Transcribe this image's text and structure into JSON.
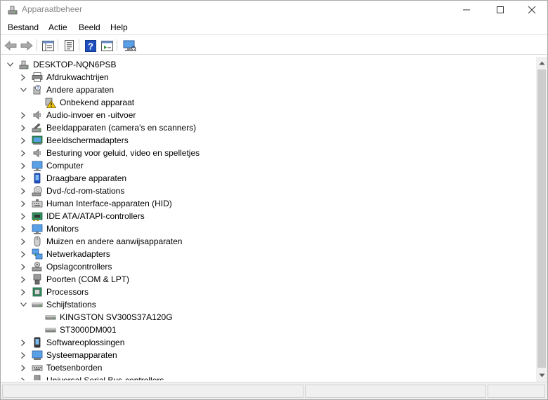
{
  "window": {
    "title": "Apparaatbeheer"
  },
  "menu": {
    "items": [
      "Bestand",
      "Actie",
      "Beeld",
      "Help"
    ]
  },
  "toolbar": {
    "buttons": [
      "back-icon",
      "forward-icon",
      "properties-icon",
      "update-driver-icon",
      "help-icon",
      "console-icon",
      "scan-hardware-icon"
    ]
  },
  "tree": {
    "root": "DESKTOP-NQN6PSB",
    "items": [
      {
        "label": "Afdrukwachtrijen",
        "icon": "printer-icon",
        "state": "collapsed",
        "level": 1
      },
      {
        "label": "Andere apparaten",
        "icon": "unknown-device-icon",
        "state": "expanded",
        "level": 1
      },
      {
        "label": "Onbekend apparaat",
        "icon": "warning-device-icon",
        "state": "leaf",
        "level": 2
      },
      {
        "label": "Audio-invoer en -uitvoer",
        "icon": "speaker-icon",
        "state": "collapsed",
        "level": 1
      },
      {
        "label": "Beeldapparaten (camera's en scanners)",
        "icon": "camera-icon",
        "state": "collapsed",
        "level": 1
      },
      {
        "label": "Beeldschermadapters",
        "icon": "display-adapter-icon",
        "state": "collapsed",
        "level": 1
      },
      {
        "label": "Besturing voor geluid, video en spelletjes",
        "icon": "sound-icon",
        "state": "collapsed",
        "level": 1
      },
      {
        "label": "Computer",
        "icon": "computer-icon",
        "state": "collapsed",
        "level": 1
      },
      {
        "label": "Draagbare apparaten",
        "icon": "portable-device-icon",
        "state": "collapsed",
        "level": 1
      },
      {
        "label": "Dvd-/cd-rom-stations",
        "icon": "dvd-icon",
        "state": "collapsed",
        "level": 1
      },
      {
        "label": "Human Interface-apparaten (HID)",
        "icon": "hid-icon",
        "state": "collapsed",
        "level": 1
      },
      {
        "label": "IDE ATA/ATAPI-controllers",
        "icon": "ide-controller-icon",
        "state": "collapsed",
        "level": 1
      },
      {
        "label": "Monitors",
        "icon": "monitor-icon",
        "state": "collapsed",
        "level": 1
      },
      {
        "label": "Muizen en andere aanwijsapparaten",
        "icon": "mouse-icon",
        "state": "collapsed",
        "level": 1
      },
      {
        "label": "Netwerkadapters",
        "icon": "network-adapter-icon",
        "state": "collapsed",
        "level": 1
      },
      {
        "label": "Opslagcontrollers",
        "icon": "storage-controller-icon",
        "state": "collapsed",
        "level": 1
      },
      {
        "label": "Poorten (COM & LPT)",
        "icon": "port-icon",
        "state": "collapsed",
        "level": 1
      },
      {
        "label": "Processors",
        "icon": "processor-icon",
        "state": "collapsed",
        "level": 1
      },
      {
        "label": "Schijfstations",
        "icon": "disk-drive-icon",
        "state": "expanded",
        "level": 1
      },
      {
        "label": "KINGSTON SV300S37A120G",
        "icon": "disk-drive-icon",
        "state": "leaf",
        "level": 2
      },
      {
        "label": "ST3000DM001",
        "icon": "disk-drive-icon",
        "state": "leaf",
        "level": 2
      },
      {
        "label": "Softwareoplossingen",
        "icon": "software-icon",
        "state": "collapsed",
        "level": 1
      },
      {
        "label": "Systeemapparaten",
        "icon": "system-device-icon",
        "state": "collapsed",
        "level": 1
      },
      {
        "label": "Toetsenborden",
        "icon": "keyboard-icon",
        "state": "collapsed",
        "level": 1
      },
      {
        "label": "Universal Serial Bus-controllers",
        "icon": "usb-icon",
        "state": "collapsed",
        "level": 1
      }
    ]
  },
  "colors": {
    "accent": "#0078d7",
    "warning": "#f2c811",
    "text": "#000000",
    "title_inactive": "#8a8a8a"
  }
}
